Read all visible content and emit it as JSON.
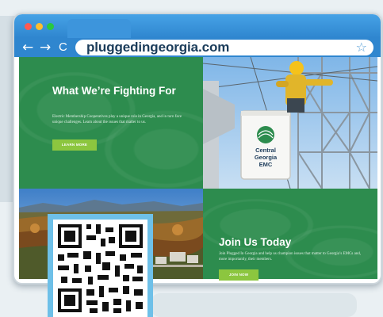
{
  "browser": {
    "url": "pluggedingeorgia.com",
    "window_dots": [
      "#ff5a52",
      "#ffbd2e",
      "#28c840"
    ],
    "nav_icons": [
      "back-arrow-icon",
      "forward-arrow-icon",
      "reload-icon"
    ],
    "back_glyph": "←",
    "forward_glyph": "→",
    "reload_glyph": "C",
    "star_glyph": "☆",
    "menu_glyph": "⋮"
  },
  "hero": {
    "title": "What We’re Fighting For",
    "body": "Electric Membership Cooperatives play a unique role in Georgia, and in turn face unique challenges. Learn about the issues that matter to us.",
    "button_label": "LEARN MORE"
  },
  "photo": {
    "logo_lines": [
      "Central",
      "Georgia",
      "EMC"
    ]
  },
  "join": {
    "title": "Join Us Today",
    "body": "Join Plugged In Georgia and help us champion issues that matter to Georgia’s EMCs and, more importantly, their members.",
    "button_label": "JOIN NOW"
  },
  "colors": {
    "brand_green": "#2d8c4e",
    "button_green": "#8cc63f",
    "browser_blue": "#2f86cf",
    "qr_frame": "#6ec0e8"
  }
}
